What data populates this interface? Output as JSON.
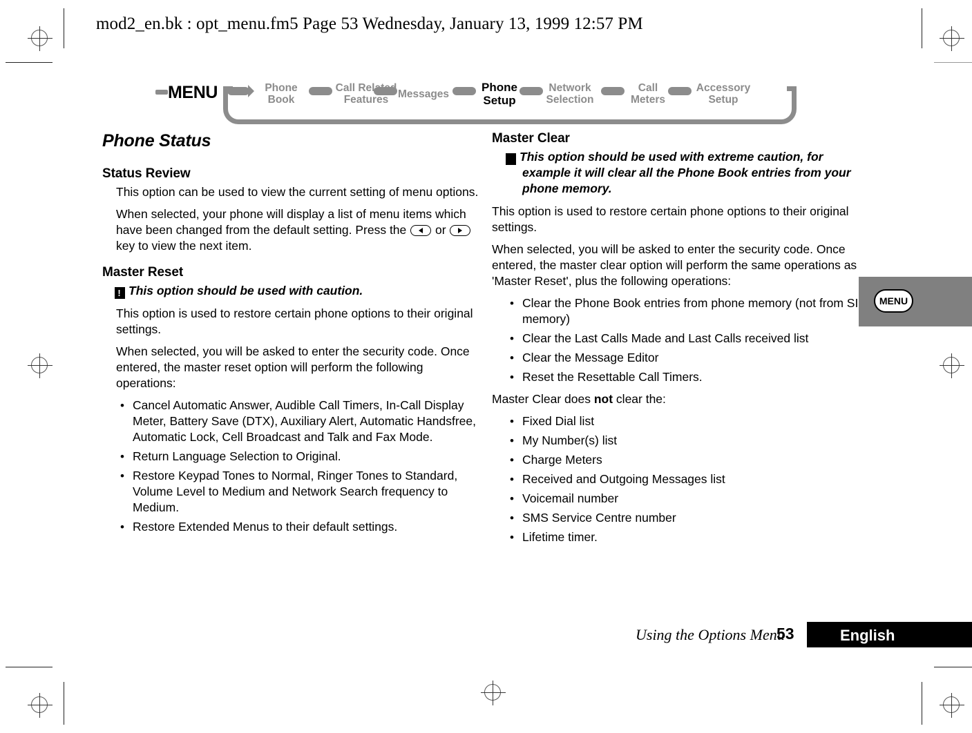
{
  "header": {
    "file_info": "mod2_en.bk : opt_menu.fm5  Page 53  Wednesday, January 13, 1999  12:57 PM"
  },
  "menu_strip": {
    "root_label": "MENU",
    "items": [
      {
        "label_lines": [
          "Phone",
          "Book"
        ],
        "active": false
      },
      {
        "label_lines": [
          "Call Related",
          "Features"
        ],
        "active": false
      },
      {
        "label_lines": [
          "Messages"
        ],
        "active": false
      },
      {
        "label_lines": [
          "Phone",
          "Setup"
        ],
        "active": true
      },
      {
        "label_lines": [
          "Network",
          "Selection"
        ],
        "active": false
      },
      {
        "label_lines": [
          "Call",
          "Meters"
        ],
        "active": false
      },
      {
        "label_lines": [
          "Accessory",
          "Setup"
        ],
        "active": false
      }
    ],
    "item0_line0": "Phone",
    "item0_line1": "Book",
    "item1_line0": "Call Related",
    "item1_line1": "Features",
    "item2_line0": "Messages",
    "item3_line0": "Phone",
    "item3_line1": "Setup",
    "item4_line0": "Network",
    "item4_line1": "Selection",
    "item5_line0": "Call",
    "item5_line1": "Meters",
    "item6_line0": "Accessory",
    "item6_line1": "Setup"
  },
  "left_column": {
    "chapter_title": "Phone Status",
    "status_review": {
      "heading": "Status Review",
      "para1": "This option can be used to view the current setting of menu options.",
      "para2_part1": "When selected, your phone will display a list of menu items which have been changed from the default setting. Press the",
      "para2_or": "or",
      "para2_part2": "key to view the next item."
    },
    "master_reset": {
      "heading": "Master Reset",
      "warning_icon": "exclamation-icon",
      "warning": "This option should be used with caution.",
      "para1": "This option is used to restore certain phone options to their original settings.",
      "para2": "When selected, you will be asked to enter the security code. Once entered, the master reset option will perform the following operations:",
      "bullets": [
        "Cancel Automatic Answer, Audible Call Timers, In-Call Display Meter, Battery Save (DTX), Auxiliary Alert, Automatic Handsfree, Automatic Lock, Cell Broadcast and Talk and Fax Mode.",
        "Return Language Selection to Original.",
        "Restore Keypad Tones to Normal, Ringer Tones to Standard, Volume Level to Medium and Network Search frequency to Medium.",
        "Restore Extended Menus to their default settings."
      ],
      "bullet0": "Cancel Automatic Answer, Audible Call Timers, In-Call Display Meter, Battery Save (DTX), Auxiliary Alert, Automatic Handsfree, Automatic Lock, Cell Broadcast and Talk and Fax Mode.",
      "bullet1": "Return Language Selection to Original.",
      "bullet2": "Restore Keypad Tones to Normal, Ringer Tones to Standard, Volume Level to Medium and Network Search frequency to Medium.",
      "bullet3": "Restore Extended Menus to their default settings."
    }
  },
  "right_column": {
    "master_clear": {
      "heading": "Master Clear",
      "warning_icon": "exclamation-icon",
      "warning": "This option should be used with extreme caution, for example it will clear all the Phone Book entries from your phone memory.",
      "para1": "This option is used to restore certain phone options to their original settings.",
      "para2": "When selected, you will be asked to enter the security code. Once entered, the master clear option will perform the same operations as 'Master Reset', plus the following operations:",
      "bullets": [
        "Clear the Phone Book entries from phone memory (not from SIM memory)",
        "Clear the Last Calls Made and Last Calls received list",
        "Clear the Message Editor",
        "Reset the Resettable Call Timers."
      ],
      "bullet0": "Clear the Phone Book entries from phone memory (not from SIM memory)",
      "bullet1": "Clear the Last Calls Made and Last Calls received list",
      "bullet2": "Clear the Message Editor",
      "bullet3": "Reset the Resettable Call Timers.",
      "not_clear_prefix": "Master Clear does ",
      "not_clear_bold": "not",
      "not_clear_suffix": " clear the:",
      "not_bullets": [
        "Fixed Dial list",
        "My Number(s) list",
        "Charge Meters",
        "Received and Outgoing Messages list",
        "Voicemail number",
        "SMS Service Centre number",
        "Lifetime timer."
      ],
      "not_bullet0": "Fixed Dial list",
      "not_bullet1": "My Number(s) list",
      "not_bullet2": "Charge Meters",
      "not_bullet3": "Received and Outgoing Messages list",
      "not_bullet4": "Voicemail number",
      "not_bullet5": "SMS Service Centre number",
      "not_bullet6": "Lifetime timer."
    }
  },
  "side_tab": {
    "label": "MENU"
  },
  "footer": {
    "section_note": "Using the Options Menu",
    "page_number": "53",
    "language": "English"
  },
  "colors": {
    "menu_gray": "#8c8c8c",
    "side_tab_gray": "#808080",
    "footer_bar": "#000000",
    "text": "#000000"
  }
}
